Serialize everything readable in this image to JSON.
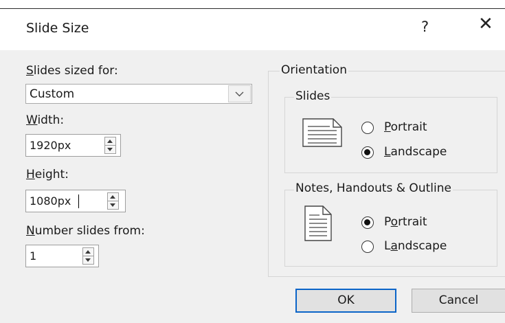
{
  "dialog": {
    "title": "Slide Size",
    "help_label": "?",
    "close_label": "✕"
  },
  "left": {
    "sized_for_label_key": "S",
    "sized_for_label_rest": "lides sized for:",
    "sized_for_value": "Custom",
    "width_label_key": "W",
    "width_label_rest": "idth:",
    "width_value": "1920px",
    "height_label_key": "H",
    "height_label_rest": "eight:",
    "height_value": "1080px",
    "number_label_key": "N",
    "number_label_rest": "umber slides from:",
    "number_value": "1"
  },
  "orientation": {
    "group_title": "Orientation",
    "slides": {
      "title": "Slides",
      "portrait_key": "P",
      "portrait_rest": "ortrait",
      "landscape_key": "L",
      "landscape_rest": "andscape",
      "selected": "Landscape"
    },
    "notes": {
      "title": "Notes, Handouts & Outline",
      "portrait_pre": "P",
      "portrait_key": "o",
      "portrait_rest": "rtrait",
      "landscape_pre": "L",
      "landscape_key": "a",
      "landscape_rest": "ndscape",
      "selected": "Portrait"
    }
  },
  "buttons": {
    "ok": "OK",
    "cancel": "Cancel"
  },
  "colors": {
    "dialog_bg": "#f0f0f0",
    "default_button_border": "#0a64c8"
  }
}
